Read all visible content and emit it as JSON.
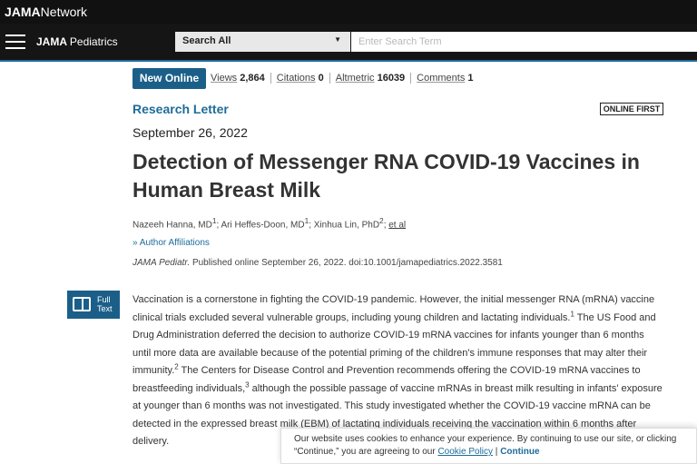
{
  "topbar": {
    "brand_bold": "JAMA",
    "brand_light": "Network"
  },
  "navbar": {
    "journal_bold": "JAMA",
    "journal_light": "Pediatrics",
    "search_select": "Search All",
    "search_placeholder": "Enter Search Term"
  },
  "article": {
    "badge": "New Online",
    "metrics": [
      {
        "label": "Views",
        "value": "2,864"
      },
      {
        "label": "Citations",
        "value": "0"
      },
      {
        "label": "Altmetric",
        "value": "16039"
      },
      {
        "label": "Comments",
        "value": "1"
      }
    ],
    "type": "Research Letter",
    "online_first": "ONLINE FIRST",
    "date": "September 26, 2022",
    "title": "Detection of Messenger RNA COVID-19 Vaccines in Human Breast Milk",
    "authors": [
      {
        "name": "Nazeeh Hanna, MD",
        "sup": "1"
      },
      {
        "name": "Ari Heffes-Doon, MD",
        "sup": "1"
      },
      {
        "name": "Xinhua Lin, PhD",
        "sup": "2"
      }
    ],
    "et_al": "et al",
    "affiliations_label": "Author Affiliations",
    "journal_abbrev": "JAMA Pediatr.",
    "citation_rest": " Published online September 26, 2022. doi:10.1001/jamapediatrics.2022.3581",
    "full_text_line1": "Full",
    "full_text_line2": "Text",
    "body": {
      "p1": "Vaccination is a cornerstone in fighting the COVID-19 pandemic. However, the initial messenger RNA (mRNA) vaccine clinical trials excluded several vulnerable groups, including young children and lactating individuals.",
      "ref1": "1",
      "p2": " The US Food and Drug Administration deferred the decision to authorize COVID-19 mRNA vaccines for infants younger than 6 months until more data are available because of the potential priming of the children's immune responses that may alter their immunity.",
      "ref2": "2",
      "p3": " The Centers for Disease Control and Prevention recommends offering the COVID-19 mRNA vaccines to breastfeeding individuals,",
      "ref3": "3",
      "p4": " although the possible passage of vaccine mRNAs in breast milk resulting in infants' exposure at younger than 6 months was not investigated. This study investigated whether the COVID-19 vaccine mRNA can be detected in the expressed breast milk (EBM) of lactating individuals receiving the vaccination within 6 months after delivery."
    }
  },
  "cookie": {
    "text": "Our website uses cookies to enhance your experience. By continuing to use our site, or clicking “Continue,” you are agreeing to our ",
    "policy_link": "Cookie Policy",
    "separator": " | ",
    "continue": "Continue"
  }
}
